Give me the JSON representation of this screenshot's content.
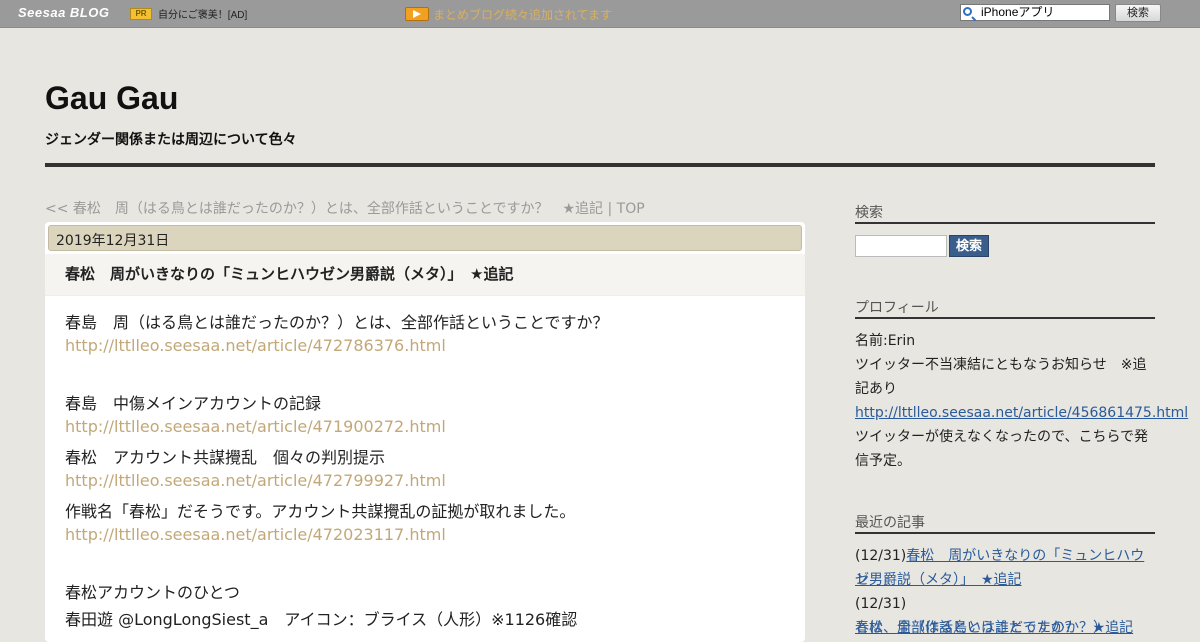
{
  "topbar": {
    "logo": "Seesaa BLOG",
    "pr_badge": "PR",
    "pr_text": "自分にご褒美！[AD]",
    "notice": "まとめブログ続々追加されてます",
    "search_value": "iPhoneアプリ",
    "search_button": "検索"
  },
  "header": {
    "title": "Gau Gau",
    "description": "ジェンダー関係または周辺について色々",
    "crumb_prev": "<< 春松　周（はる鳥とは誰だったのか？）とは、全部作話ということですか？　★追記",
    "crumb_sep": " | ",
    "crumb_top": "TOP"
  },
  "article": {
    "date": "2019年12月31日",
    "title": "春松　周がいきなりの「ミュンヒハウゼン男爵説（メタ）」　★追記",
    "lines": [
      {
        "text": "春島　周（はる鳥とは誰だったのか？）とは、全部作話ということですか？"
      },
      {
        "text": "http://lttlleo.seesaa.net/article/472786376.html"
      },
      {
        "text": "春島　中傷メインアカウントの記録"
      },
      {
        "text": "http://lttlleo.seesaa.net/article/471900272.html"
      },
      {
        "text": "春松　アカウント共謀攪乱　個々の判別提示"
      },
      {
        "text": "http://lttlleo.seesaa.net/article/472799927.html"
      },
      {
        "text": "作戦名「春松」だそうです。アカウント共謀攪乱の証拠が取れました。"
      },
      {
        "text": "http://lttlleo.seesaa.net/article/472023117.html"
      },
      {
        "text": "春松アカウントのひとつ"
      },
      {
        "text": "春田遊 @LongLongSiest_a　アイコン：ブライス（人形）※1126確認"
      }
    ]
  },
  "sidebar": {
    "search_heading": "検索",
    "search_button": "検索",
    "profile_heading": "プロフィール",
    "profile_name": "名前:Erin",
    "profile_notice_1": "ツイッター不当凍結にともなうお知らせ　※追",
    "profile_notice_2": "記あり",
    "profile_link": "http://lttlleo.seesaa.net/article/456861475.html",
    "profile_plan_1": "ツイッターが使えなくなったので、こちらで発",
    "profile_plan_2": "信予定。",
    "recent_heading": "最近の記事",
    "recent": [
      {
        "date": "(12/31)",
        "title_1": "春松　周がいきなりの「ミュンヒハウゼ",
        "title_2": "ン男爵説（メタ）」　★追記"
      },
      {
        "date": "(12/31)",
        "title_1": "春松　周（はる鳥とは誰だったのか？）",
        "title_2": "とは、全部作話ということですか？　★追記"
      }
    ]
  }
}
